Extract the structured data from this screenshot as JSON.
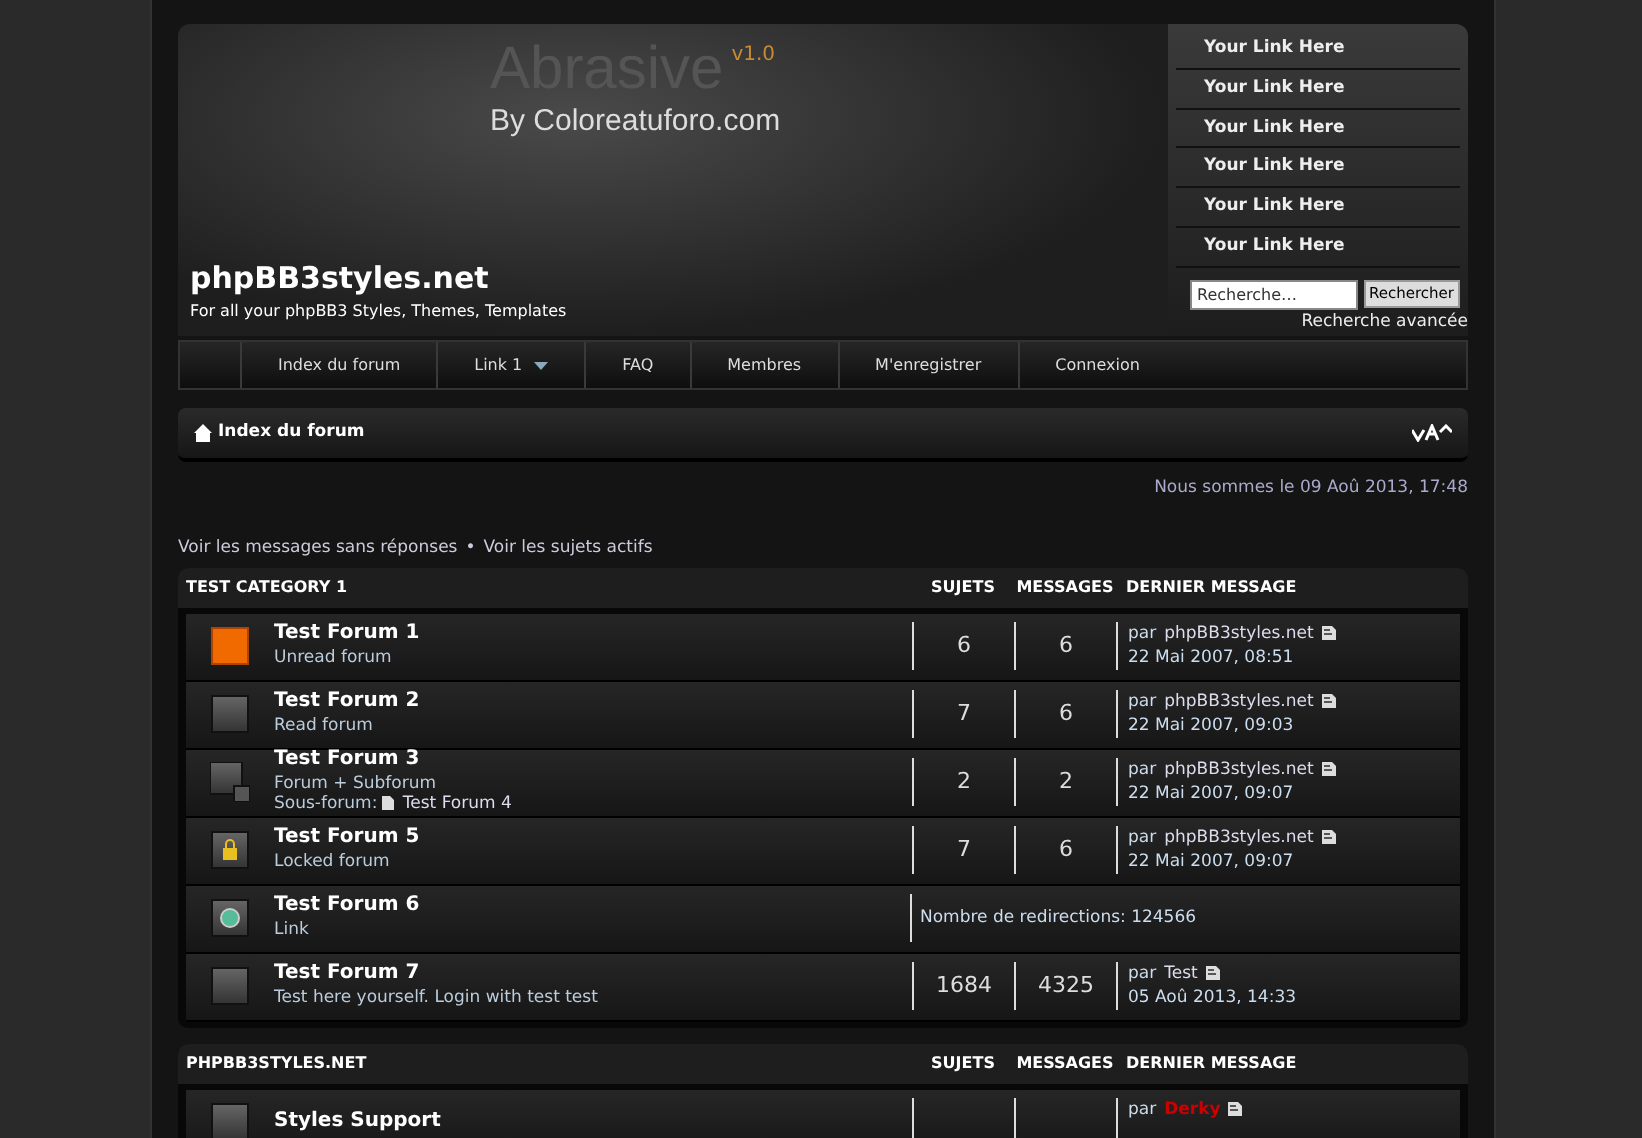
{
  "header": {
    "banner": {
      "title": "Abrasive",
      "version": "v1.0",
      "byline": "By Coloreatuforo.com"
    },
    "site_name": "phpBB3styles.net",
    "site_desc": "For all your phpBB3 Styles, Themes, Templates",
    "links": [
      "Your Link Here",
      "Your Link Here",
      "Your Link Here",
      "Your Link Here",
      "Your Link Here",
      "Your Link Here"
    ],
    "search": {
      "placeholder": "Recherche…",
      "button": "Rechercher",
      "advanced": "Recherche avancée"
    }
  },
  "nav": [
    {
      "label": "Index du forum",
      "dropdown": false
    },
    {
      "label": "Link 1",
      "dropdown": true
    },
    {
      "label": "FAQ",
      "dropdown": false
    },
    {
      "label": "Membres",
      "dropdown": false
    },
    {
      "label": "M'enregistrer",
      "dropdown": false
    },
    {
      "label": "Connexion",
      "dropdown": false
    }
  ],
  "breadcrumb": "Index du forum",
  "date": "Nous sommes le 09 Aoû 2013, 17:48",
  "quick_links": [
    "Voir les messages sans réponses",
    "Voir les sujets actifs"
  ],
  "quick_links_separator": "•",
  "categories": [
    {
      "title": "TEST CATEGORY 1",
      "columns": [
        "SUJETS",
        "MESSAGES",
        "DERNIER MESSAGE"
      ],
      "forums": [
        {
          "kind": "unread",
          "name": "Test Forum 1",
          "desc": "Unread forum",
          "topics": "6",
          "posts": "6",
          "by_label": "par",
          "last_by": "phpBB3styles.net",
          "last_date": "22 Mai 2007, 08:51"
        },
        {
          "kind": "read",
          "name": "Test Forum 2",
          "desc": "Read forum",
          "topics": "7",
          "posts": "6",
          "by_label": "par",
          "last_by": "phpBB3styles.net",
          "last_date": "22 Mai 2007, 09:03"
        },
        {
          "kind": "subforum",
          "name": "Test Forum 3",
          "desc": "Forum + Subforum",
          "subforum_label": "Sous-forum:",
          "subforum": "Test Forum 4",
          "topics": "2",
          "posts": "2",
          "by_label": "par",
          "last_by": "phpBB3styles.net",
          "last_date": "22 Mai 2007, 09:07"
        },
        {
          "kind": "locked",
          "name": "Test Forum 5",
          "desc": "Locked forum",
          "topics": "7",
          "posts": "6",
          "by_label": "par",
          "last_by": "phpBB3styles.net",
          "last_date": "22 Mai 2007, 09:07"
        },
        {
          "kind": "link",
          "name": "Test Forum 6",
          "desc": "Link",
          "redirects": "Nombre de redirections: 124566"
        },
        {
          "kind": "read",
          "name": "Test Forum 7",
          "desc": "Test here yourself. Login with test test",
          "topics": "1684",
          "posts": "4325",
          "by_label": "par",
          "last_by": "Test",
          "last_date": "05 Aoû 2013, 14:33"
        }
      ]
    },
    {
      "title": "PHPBB3STYLES.NET",
      "columns": [
        "SUJETS",
        "MESSAGES",
        "DERNIER MESSAGE"
      ],
      "forums": [
        {
          "kind": "read",
          "name": "Styles Support",
          "by_label": "par",
          "last_by": "Derky",
          "color": "#cc0000"
        }
      ]
    }
  ]
}
